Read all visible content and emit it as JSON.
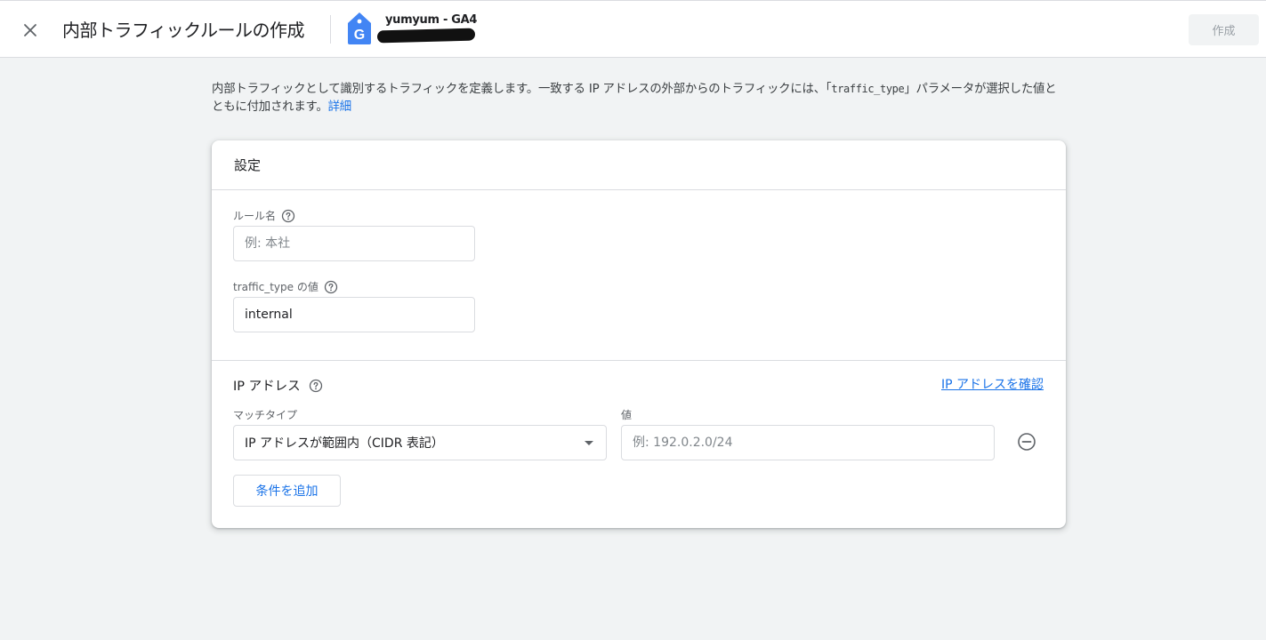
{
  "header": {
    "title": "内部トラフィックルールの作成",
    "property_name": "yumyum - GA4",
    "create_label": "作成",
    "icons": {
      "close": "close-icon",
      "property": "analytics-property-tag-icon"
    }
  },
  "description": {
    "before": "内部トラフィックとして識別するトラフィックを定義します。一致する IP アドレスの外部からのトラフィックには、「",
    "code": "traffic_type",
    "after": "」パラメータが選択した値とともに付加されます。",
    "link": "詳細"
  },
  "card": {
    "title": "設定",
    "rule_name": {
      "label": "ルール名",
      "placeholder": "例: 本社",
      "value": ""
    },
    "traffic_type": {
      "label": "traffic_type の値",
      "value": "internal"
    },
    "ip": {
      "title": "IP アドレス",
      "check_link": "IP アドレスを確認",
      "match_type_label": "マッチタイプ",
      "match_type_value": "IP アドレスが範囲内（CIDR 表記）",
      "value_label": "値",
      "value_placeholder": "例: 192.0.2.0/24",
      "value": ""
    },
    "add_condition_label": "条件を追加"
  },
  "colors": {
    "accent": "#1a73e8",
    "logo": "#4285f4",
    "background": "#f1f3f4"
  }
}
